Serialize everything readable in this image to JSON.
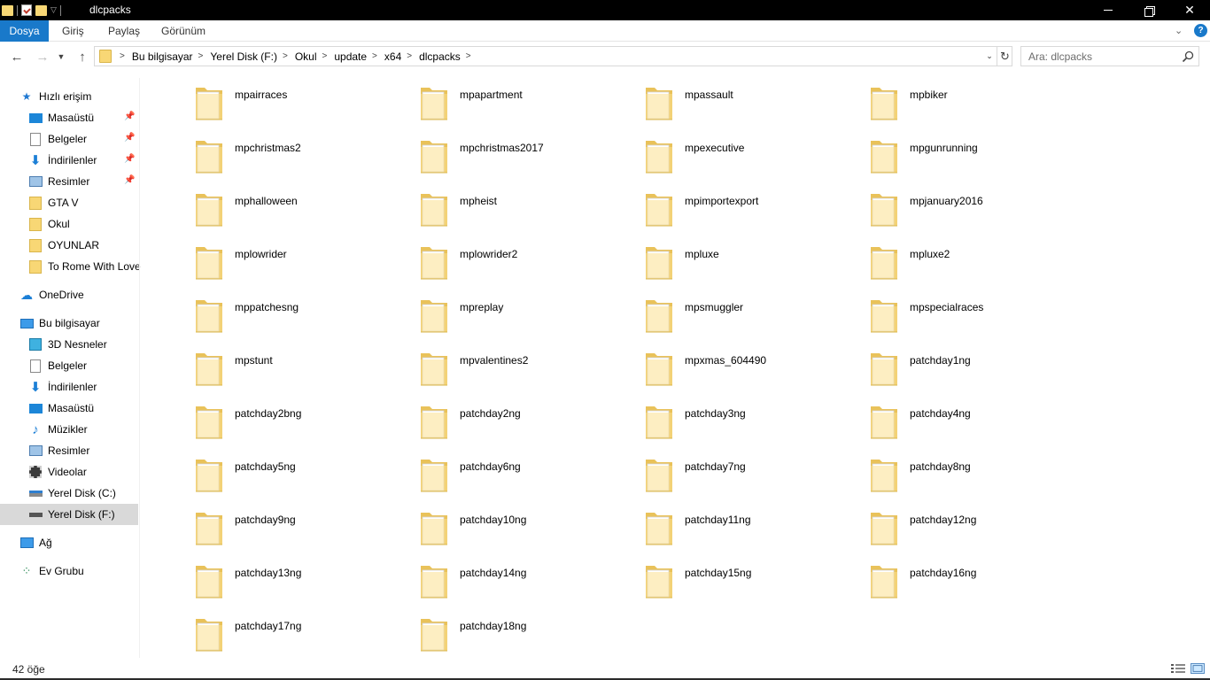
{
  "window": {
    "title": "dlcpacks"
  },
  "ribbon": {
    "tabs": [
      "Dosya",
      "Giriş",
      "Paylaş",
      "Görünüm"
    ],
    "help_label": "?"
  },
  "address": {
    "path": [
      "Bu bilgisayar",
      "Yerel Disk (F:)",
      "Okul",
      "update",
      "x64",
      "dlcpacks"
    ]
  },
  "search": {
    "placeholder": "Ara: dlcpacks"
  },
  "sidebar": {
    "quick_access": {
      "label": "Hızlı erişim",
      "items": [
        {
          "label": "Masaüstü",
          "icon": "desktop-icon",
          "pinned": true
        },
        {
          "label": "Belgeler",
          "icon": "documents-icon",
          "pinned": true
        },
        {
          "label": "İndirilenler",
          "icon": "downloads-icon",
          "pinned": true
        },
        {
          "label": "Resimler",
          "icon": "pictures-icon",
          "pinned": true
        },
        {
          "label": "GTA V",
          "icon": "folder-icon",
          "pinned": false
        },
        {
          "label": "Okul",
          "icon": "folder-icon",
          "pinned": false
        },
        {
          "label": "OYUNLAR",
          "icon": "folder-icon",
          "pinned": false
        },
        {
          "label": "To Rome With Love",
          "icon": "folder-icon",
          "pinned": false
        }
      ]
    },
    "onedrive": {
      "label": "OneDrive"
    },
    "this_pc": {
      "label": "Bu bilgisayar",
      "items": [
        {
          "label": "3D Nesneler",
          "icon": "3d-objects-icon"
        },
        {
          "label": "Belgeler",
          "icon": "documents-icon"
        },
        {
          "label": "İndirilenler",
          "icon": "downloads-icon"
        },
        {
          "label": "Masaüstü",
          "icon": "desktop-icon"
        },
        {
          "label": "Müzikler",
          "icon": "music-icon"
        },
        {
          "label": "Resimler",
          "icon": "pictures-icon"
        },
        {
          "label": "Videolar",
          "icon": "videos-icon"
        },
        {
          "label": "Yerel Disk (C:)",
          "icon": "drive-c-icon"
        },
        {
          "label": "Yerel Disk (F:)",
          "icon": "drive-icon",
          "selected": true
        }
      ]
    },
    "network": {
      "label": "Ağ"
    },
    "homegroup": {
      "label": "Ev Grubu"
    }
  },
  "files": [
    "mpairraces",
    "mpapartment",
    "mpassault",
    "mpbiker",
    "mpchristmas2",
    "mpchristmas2017",
    "mpexecutive",
    "mpgunrunning",
    "mphalloween",
    "mpheist",
    "mpimportexport",
    "mpjanuary2016",
    "mplowrider",
    "mplowrider2",
    "mpluxe",
    "mpluxe2",
    "mppatchesng",
    "mpreplay",
    "mpsmuggler",
    "mpspecialraces",
    "mpstunt",
    "mpvalentines2",
    "mpxmas_604490",
    "patchday1ng",
    "patchday2bng",
    "patchday2ng",
    "patchday3ng",
    "patchday4ng",
    "patchday5ng",
    "patchday6ng",
    "patchday7ng",
    "patchday8ng",
    "patchday9ng",
    "patchday10ng",
    "patchday11ng",
    "patchday12ng",
    "patchday13ng",
    "patchday14ng",
    "patchday15ng",
    "patchday16ng",
    "patchday17ng",
    "patchday18ng"
  ],
  "status": {
    "item_count": "42 öğe"
  },
  "colors": {
    "accent": "#1979ca",
    "folder": "#f8d775",
    "selection": "#cce8ff"
  }
}
